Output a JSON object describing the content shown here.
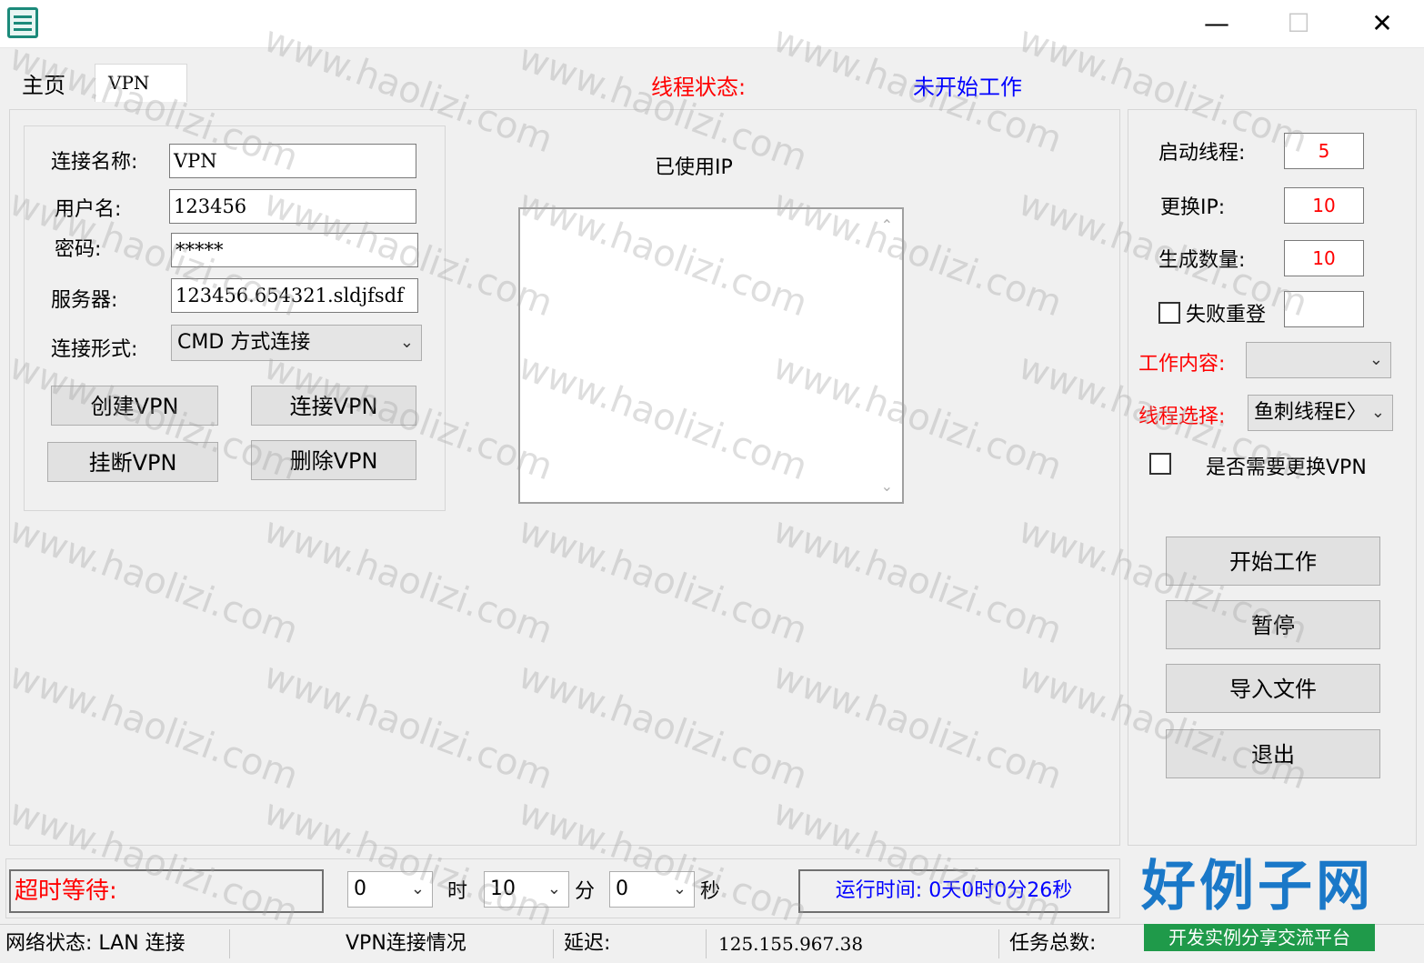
{
  "window": {
    "minimize_glyph": "—",
    "maximize_glyph": "☐",
    "close_glyph": "✕"
  },
  "tabs": [
    {
      "label": "主页"
    },
    {
      "label": "VPN"
    }
  ],
  "thread_status": {
    "label": "线程状态:",
    "value": "未开始工作"
  },
  "vpn_form": {
    "connection_name_label": "连接名称:",
    "connection_name_value": "VPN",
    "username_label": "用户名:",
    "username_value": "123456",
    "password_label": "密码:",
    "password_value": "*****",
    "server_label": "服务器:",
    "server_value": "123456.654321.sldjfsdf",
    "connection_type_label": "连接形式:",
    "connection_type_value": "CMD 方式连接",
    "create_vpn": "创建VPN",
    "connect_vpn": "连接VPN",
    "hangup_vpn": "挂断VPN",
    "delete_vpn": "删除VPN"
  },
  "used_ip": {
    "title": "已使用IP"
  },
  "settings": {
    "start_threads_label": "启动线程:",
    "start_threads_value": "5",
    "change_ip_label": "更换IP:",
    "change_ip_value": "10",
    "generate_count_label": "生成数量:",
    "generate_count_value": "10",
    "fail_relogin_label": "失败重登",
    "fail_relogin_value": "",
    "work_content_label": "工作内容:",
    "work_content_value": "",
    "thread_select_label": "线程选择:",
    "thread_select_value": "鱼刺线程E〉",
    "need_change_vpn_label": "是否需要更换VPN"
  },
  "actions": {
    "start": "开始工作",
    "pause": "暂停",
    "import": "导入文件",
    "exit": "退出"
  },
  "timeout": {
    "label": "超时等待:",
    "hours_value": "0",
    "hours_unit": "时",
    "minutes_value": "10",
    "minutes_unit": "分",
    "seconds_value": "0",
    "seconds_unit": "秒",
    "runtime": "运行时间: 0天0时0分26秒"
  },
  "statusbar": {
    "network": "网络状态: LAN 连接",
    "vpn_status": "VPN连接情况",
    "latency": "延迟:",
    "ip": "125.155.967.38",
    "task_total": "任务总数:"
  },
  "watermark_text": "www.haolizi.com",
  "logo": {
    "main": "好例子网",
    "sub": "开发实例分享交流平台"
  },
  "colors": {
    "accent_red": "#ff0000",
    "accent_blue": "#0000ff",
    "logo_blue": "#1a78c8",
    "logo_green": "#1f9a4a"
  }
}
